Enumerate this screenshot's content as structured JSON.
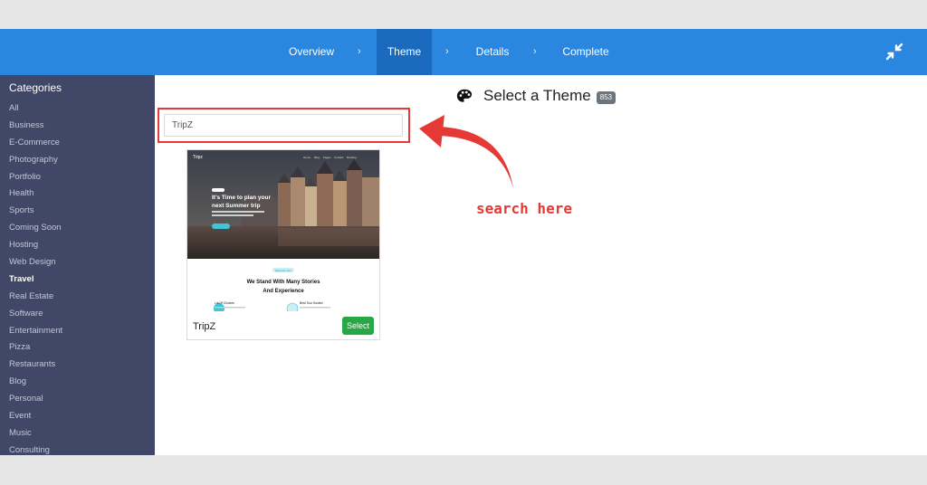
{
  "wizard": {
    "steps": [
      {
        "label": "Overview",
        "active": false
      },
      {
        "label": "Theme",
        "active": true
      },
      {
        "label": "Details",
        "active": false
      },
      {
        "label": "Complete",
        "active": false
      }
    ],
    "separator": "›"
  },
  "sidebar": {
    "title": "Categories",
    "items": [
      {
        "label": "All"
      },
      {
        "label": "Business"
      },
      {
        "label": "E-Commerce"
      },
      {
        "label": "Photography"
      },
      {
        "label": "Portfolio"
      },
      {
        "label": "Health"
      },
      {
        "label": "Sports"
      },
      {
        "label": "Coming Soon"
      },
      {
        "label": "Hosting"
      },
      {
        "label": "Web Design"
      },
      {
        "label": "Travel",
        "active": true
      },
      {
        "label": "Real Estate"
      },
      {
        "label": "Software"
      },
      {
        "label": "Entertainment"
      },
      {
        "label": "Pizza"
      },
      {
        "label": "Restaurants"
      },
      {
        "label": "Blog"
      },
      {
        "label": "Personal"
      },
      {
        "label": "Event"
      },
      {
        "label": "Music"
      },
      {
        "label": "Consulting"
      }
    ]
  },
  "main": {
    "title": "Select a Theme",
    "count": "853",
    "search": {
      "value": "TripZ"
    },
    "theme_card": {
      "name": "TripZ",
      "select_label": "Select",
      "preview": {
        "brand": "Tripz",
        "nav": [
          "Home",
          "Blog",
          "Pages",
          "Contact",
          "Booking"
        ],
        "hero_line1": "It's Time to plan your",
        "hero_line2": "next Summer trip",
        "section_tag": "Welcome Tour",
        "heading_line1": "We Stand With Many Stories",
        "heading_line2": "And Experience",
        "feature1": "Lot Of Choices",
        "feature2": "Best Tour Guided"
      }
    },
    "annotation": "search here"
  },
  "colors": {
    "topbar": "#2b86e0",
    "active_step": "#1a6bbf",
    "sidebar": "#414766",
    "select_button": "#28a745",
    "annotation": "#e53935"
  }
}
